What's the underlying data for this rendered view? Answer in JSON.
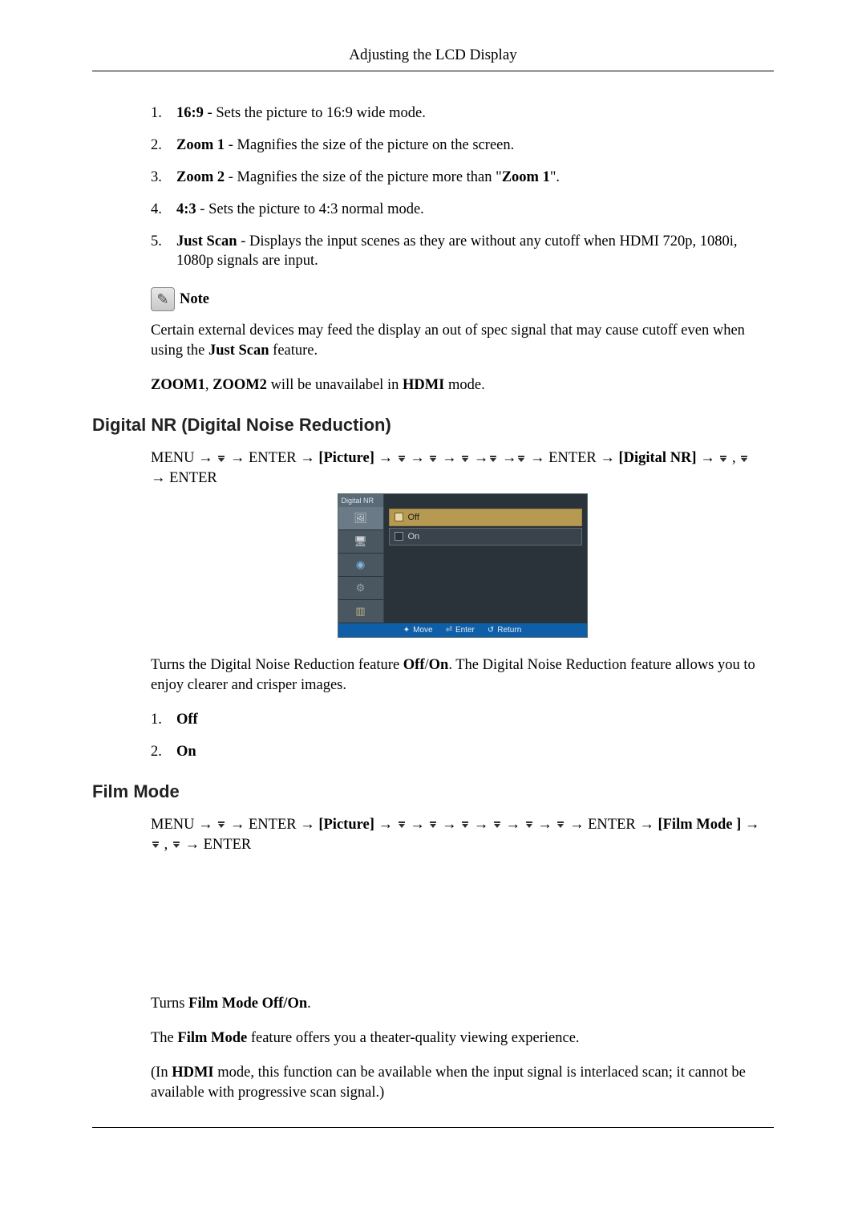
{
  "header": {
    "title": "Adjusting the LCD Display"
  },
  "picture_size_list": [
    {
      "num": "1.",
      "label": "16:9",
      "desc": " - Sets the picture to 16:9 wide mode."
    },
    {
      "num": "2.",
      "label": "Zoom 1",
      "desc": " - Magnifies the size of the picture on the screen."
    },
    {
      "num": "3.",
      "label": "Zoom 2",
      "desc_pre": " - Magnifies the size of the picture more than \"",
      "desc_bold": "Zoom 1",
      "desc_post": "\"."
    },
    {
      "num": "4.",
      "label": "4:3",
      "desc": " - Sets the picture to 4:3 normal mode."
    },
    {
      "num": "5.",
      "label": "Just Scan",
      "desc": " - Displays the input scenes as they are without any cutoff when HDMI 720p, 1080i, 1080p signals are input."
    }
  ],
  "note": {
    "label": "Note",
    "para1_pre": "Certain external devices may feed the display an out of spec signal that may cause cutoff even when using the ",
    "para1_bold": "Just Scan",
    "para1_post": " feature.",
    "para2_b1": "ZOOM1",
    "para2_sep": ", ",
    "para2_b2": "ZOOM2",
    "para2_mid": " will be unavailabel in ",
    "para2_b3": "HDMI",
    "para2_post": " mode."
  },
  "digital_nr": {
    "heading": "Digital NR (Digital Noise Reduction)",
    "nav": {
      "p1": "MENU → ",
      "p2": " → ENTER → ",
      "p2b": "[Picture]",
      "p3": " → ",
      "p4": " → ENTER → ",
      "p4b": "[Digital NR]",
      "p5": " → ",
      "p6": " , ",
      "p7": "→ ENTER"
    },
    "osd": {
      "side_title": "Digital  NR",
      "option_off": "Off",
      "option_on": "On",
      "footer_move": "Move",
      "footer_enter": "Enter",
      "footer_return": "Return"
    },
    "desc_pre": "Turns the Digital Noise Reduction feature ",
    "desc_b1": "Off",
    "desc_sep": "/",
    "desc_b2": "On",
    "desc_post": ". The Digital Noise Reduction feature allows you to enjoy clearer and crisper images.",
    "list": [
      {
        "num": "1.",
        "label": "Off"
      },
      {
        "num": "2.",
        "label": "On"
      }
    ]
  },
  "film_mode": {
    "heading": "Film Mode",
    "nav": {
      "p1": "MENU → ",
      "p2": " → ENTER → ",
      "p2b": "[Picture]",
      "p3": " → ",
      "p4": " → ENTER → ",
      "p4b": "[Film Mode ]",
      "p5": " → ",
      "p6": " , ",
      "p7": " → ENTER"
    },
    "line1_pre": "Turns ",
    "line1_bold": "Film Mode Off/On",
    "line1_post": ".",
    "line2_pre": "The ",
    "line2_bold": "Film Mode",
    "line2_post": " feature offers you a theater-quality viewing experience.",
    "line3_pre": "(In ",
    "line3_bold": "HDMI",
    "line3_post": " mode, this function can be available when the input signal is interlaced scan; it cannot be available with progressive scan signal.)"
  }
}
